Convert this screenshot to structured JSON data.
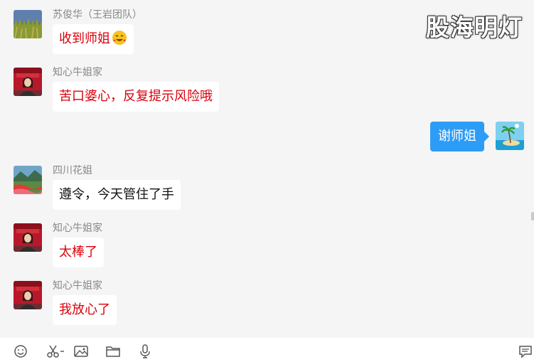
{
  "watermark": "股海明灯",
  "messages": [
    {
      "sender": "苏俊华（王岩团队）",
      "text": "收到师姐",
      "emoji": "smiling-face-with-hearts"
    },
    {
      "sender": "知心牛姐家",
      "text": "苦口婆心，反复提示风险哦"
    },
    {
      "sender": "四川花姐",
      "text": "遵令，今天管住了手"
    },
    {
      "sender": "知心牛姐家",
      "text": "太棒了"
    },
    {
      "sender": "知心牛姐家",
      "text": "我放心了"
    }
  ],
  "self_message": {
    "text": "谢师姐"
  },
  "colors": {
    "background": "#f5f5f5",
    "other_text_red": "#d9000b",
    "self_bubble": "#2d9cf7"
  },
  "toolbar": {
    "icons": [
      "emoji-icon",
      "scissors-icon",
      "image-icon",
      "folder-icon",
      "microphone-icon",
      "history-icon"
    ]
  }
}
